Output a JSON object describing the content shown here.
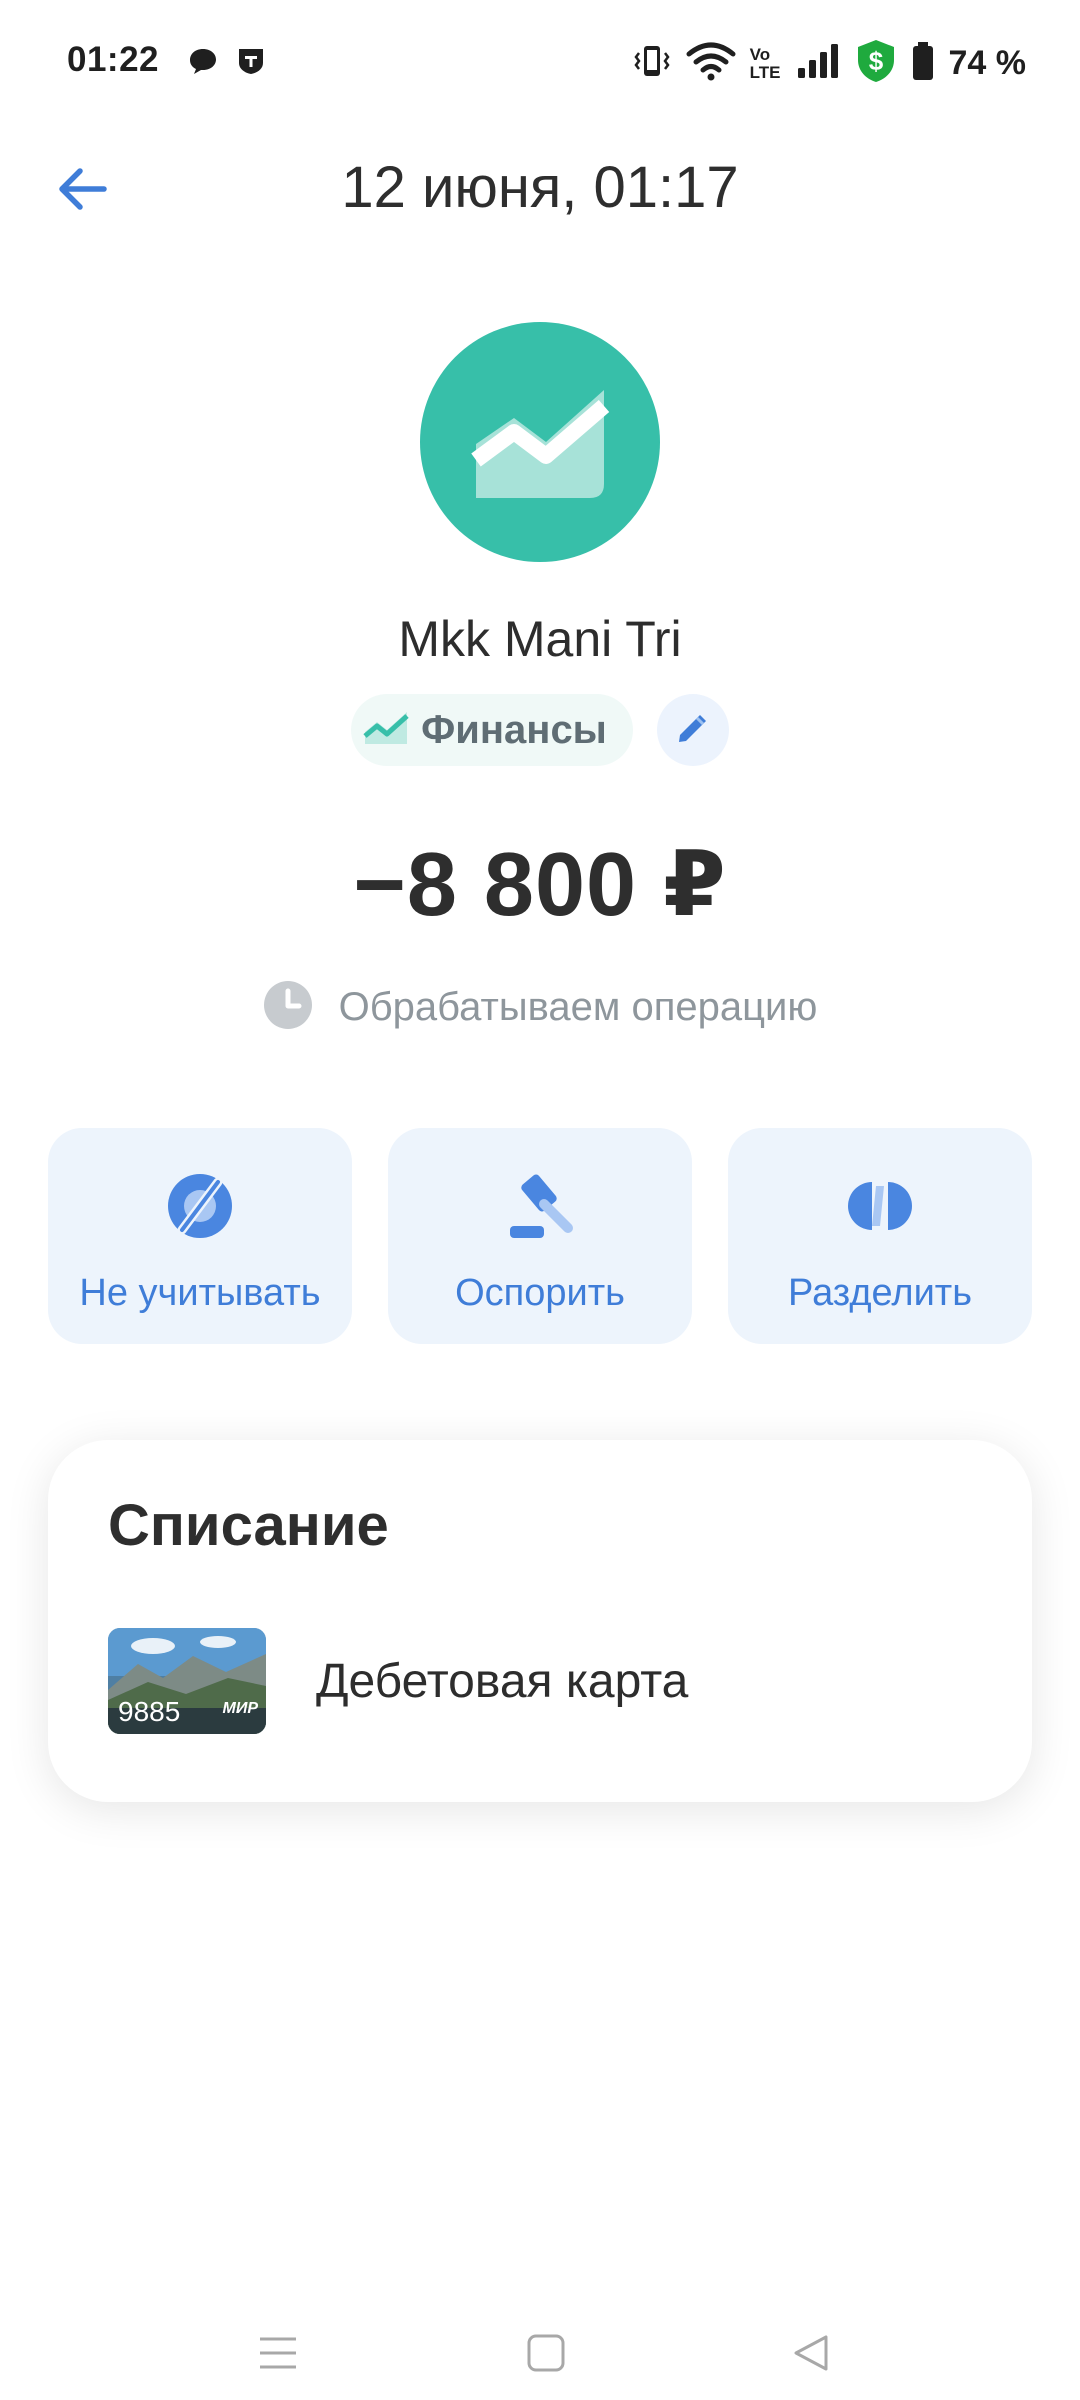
{
  "status_bar": {
    "time": "01:22",
    "battery_percent": "74 %",
    "left_icons": [
      "message-icon",
      "tinkoff-icon"
    ],
    "right_icons": [
      "vibrate-icon",
      "wifi-icon",
      "volte-icon",
      "signal-icon",
      "shield-dollar-icon",
      "battery-icon"
    ],
    "volte_top": "Vo",
    "volte_bottom": "LTE"
  },
  "header": {
    "title": "12 июня, 01:17",
    "back_icon": "arrow-left-icon"
  },
  "merchant": {
    "name": "Mkk Mani Tri",
    "logo_color": "#37bfa9",
    "category_label": "Финансы"
  },
  "amount": "−8 800 ₽",
  "operation_status": "Обрабатываем операцию",
  "actions": [
    {
      "label": "Не учитывать",
      "icon": "exclude-icon"
    },
    {
      "label": "Оспорить",
      "icon": "gavel-icon"
    },
    {
      "label": "Разделить",
      "icon": "split-icon"
    }
  ],
  "writeoff": {
    "title": "Списание",
    "card_name": "Дебетовая карта",
    "card_last4": "9885",
    "card_brand": "МИР"
  },
  "colors": {
    "accent": "#3f7dd8",
    "tile_bg": "#edf4fc",
    "logo": "#37bfa9",
    "text_primary": "#2e2e2e",
    "text_secondary": "#8e969c"
  }
}
